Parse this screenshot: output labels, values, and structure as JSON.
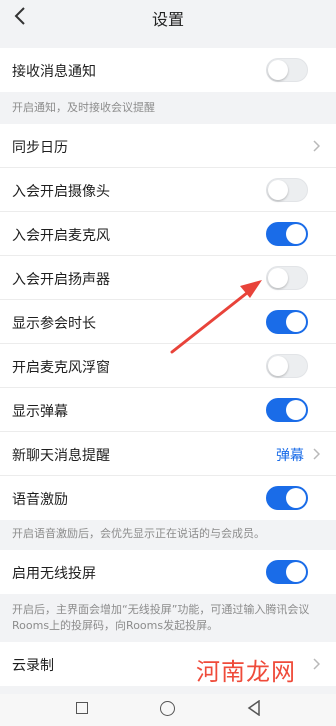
{
  "header": {
    "title": "设置",
    "back_icon": "chevron-left-icon"
  },
  "rows": {
    "receive_notifications": {
      "label": "接收消息通知",
      "on": false
    },
    "sync_calendar": {
      "label": "同步日历"
    },
    "camera_on_join": {
      "label": "入会开启摄像头",
      "on": false
    },
    "mic_on_join": {
      "label": "入会开启麦克风",
      "on": true
    },
    "speaker_on_join": {
      "label": "入会开启扬声器",
      "on": false
    },
    "show_duration": {
      "label": "显示参会时长",
      "on": true
    },
    "mic_float": {
      "label": "开启麦克风浮窗",
      "on": false
    },
    "show_danmaku": {
      "label": "显示弹幕",
      "on": true
    },
    "new_chat_alert": {
      "label": "新聊天消息提醒",
      "value": "弹幕"
    },
    "voice_motivation": {
      "label": "语音激励",
      "on": true
    },
    "wireless_cast": {
      "label": "启用无线投屏",
      "on": true
    },
    "cloud_record": {
      "label": "云录制"
    }
  },
  "hints": {
    "notifications": "开启通知，及时接收会议提醒",
    "voice_motivation": "开启语音激励后，会优先显示正在说话的与会成员。",
    "wireless_cast": "开启后，主界面会增加“无线投屏”功能，可通过输入腾讯会议Rooms上的投屏码，向Rooms发起投屏。"
  },
  "colors": {
    "accent": "#1a6ce8",
    "toggle_off": "#eceef0",
    "annotation_arrow": "#e8433a"
  },
  "navbar": {
    "icons": [
      "square-recent-icon",
      "circle-home-icon",
      "triangle-back-icon"
    ]
  },
  "watermark": "河南龙网"
}
